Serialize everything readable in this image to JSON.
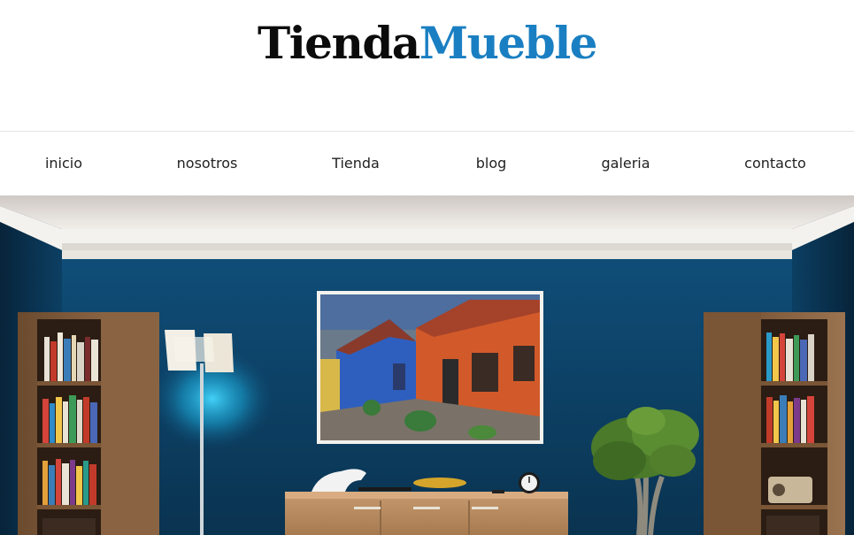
{
  "logo": {
    "part1": "Tienda",
    "part2": "Mueble"
  },
  "nav": {
    "items": [
      {
        "label": "inicio"
      },
      {
        "label": "nosotros"
      },
      {
        "label": "Tienda"
      },
      {
        "label": "blog"
      },
      {
        "label": "galeria"
      },
      {
        "label": "contacto"
      }
    ]
  },
  "hero": {
    "subject": "living-room-interior-photo"
  },
  "colors": {
    "accent": "#1a7fc2",
    "text": "#0b0b0b",
    "wall": "#0f4a73"
  }
}
